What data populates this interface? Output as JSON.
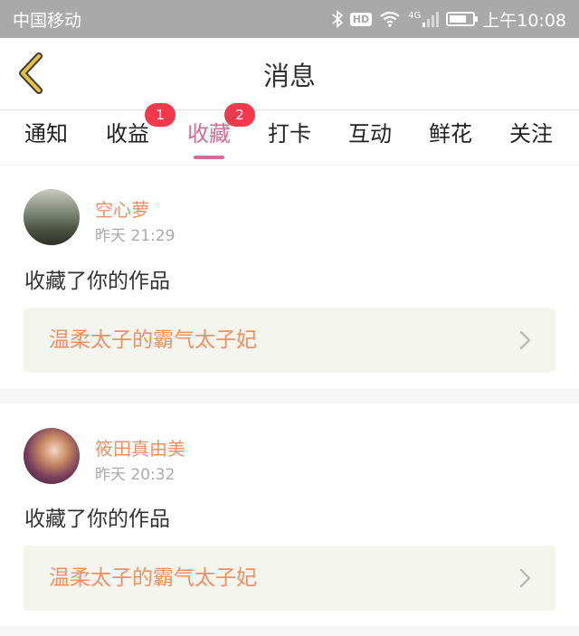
{
  "status_bar": {
    "carrier": "中国移动",
    "hd_label": "HD",
    "network_label": "4G",
    "battery_level": 0.75,
    "time": "上午10:08"
  },
  "navbar": {
    "title": "消息"
  },
  "tabs": [
    {
      "label": "通知",
      "badge": ""
    },
    {
      "label": "收益",
      "badge": "1"
    },
    {
      "label": "收藏",
      "badge": "2",
      "active": true
    },
    {
      "label": "打卡",
      "badge": ""
    },
    {
      "label": "互动",
      "badge": ""
    },
    {
      "label": "鲜花",
      "badge": ""
    },
    {
      "label": "关注",
      "badge": ""
    }
  ],
  "messages": [
    {
      "username": "空心萝",
      "time": "昨天 21:29",
      "action": "收藏了你的作品",
      "work_title": "温柔太子的霸气太子妃"
    },
    {
      "username": "筱田真由美",
      "time": "昨天 20:32",
      "action": "收藏了你的作品",
      "work_title": "温柔太子的霸气太子妃"
    }
  ],
  "colors": {
    "accent": "#d36c9b",
    "username": "#f08f64",
    "badge": "#f2384d",
    "back_arrow": "#e9c23a"
  }
}
